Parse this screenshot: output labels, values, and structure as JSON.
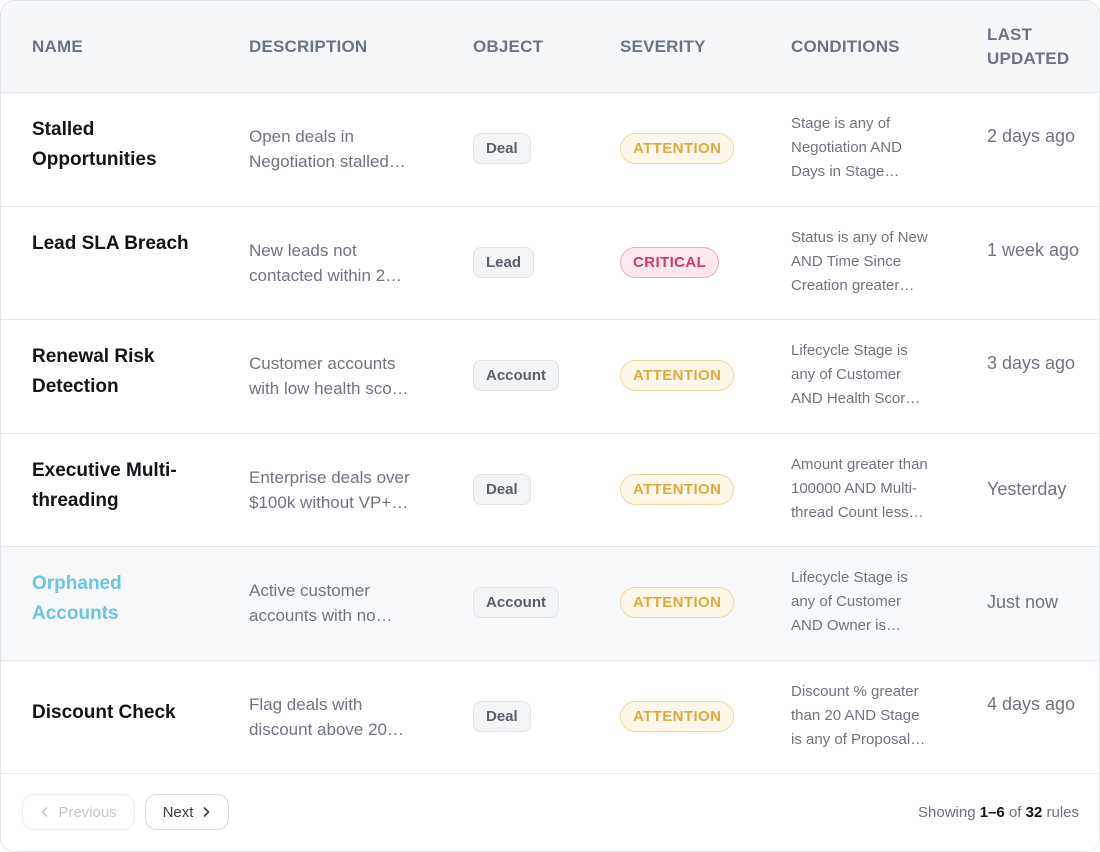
{
  "table": {
    "headers": {
      "name": "NAME",
      "description": "DESCRIPTION",
      "object": "OBJECT",
      "severity": "SEVERITY",
      "conditions": "CONDITIONS",
      "last_updated_line1": "LAST",
      "last_updated_line2": "UPDATED"
    },
    "rows": [
      {
        "name": "Stalled Opportunities",
        "desc_line1": "Open deals in",
        "desc_line2": "Negotiation stalled…",
        "object": "Deal",
        "severity": "ATTENTION",
        "cond_line1": "Stage is any of",
        "cond_line2": "Negotiation AND",
        "cond_line3": "Days in Stage…",
        "updated": "2 days ago"
      },
      {
        "name": "Lead SLA Breach",
        "desc_line1": "New leads not",
        "desc_line2": "contacted within 2…",
        "object": "Lead",
        "severity": "CRITICAL",
        "cond_line1": "Status is any of New",
        "cond_line2": "AND Time Since",
        "cond_line3": "Creation greater…",
        "updated": "1 week ago"
      },
      {
        "name": "Renewal Risk Detection",
        "desc_line1": "Customer accounts",
        "desc_line2": "with low health sco…",
        "object": "Account",
        "severity": "ATTENTION",
        "cond_line1": "Lifecycle Stage is",
        "cond_line2": "any of Customer",
        "cond_line3": "AND Health Scor…",
        "updated": "3 days ago"
      },
      {
        "name": "Executive Multi-threading",
        "desc_line1": "Enterprise deals over",
        "desc_line2": "$100k without VP+…",
        "object": "Deal",
        "severity": "ATTENTION",
        "cond_line1": "Amount greater than",
        "cond_line2": "100000 AND Multi-",
        "cond_line3": "thread Count less…",
        "updated": "Yesterday"
      },
      {
        "name": "Orphaned Accounts",
        "desc_line1": "Active customer",
        "desc_line2": "accounts with no…",
        "object": "Account",
        "severity": "ATTENTION",
        "cond_line1": "Lifecycle Stage is",
        "cond_line2": "any of Customer",
        "cond_line3": "AND Owner is…",
        "updated": "Just now"
      },
      {
        "name": "Discount Check",
        "desc_line1": "Flag deals with",
        "desc_line2": "discount above 20…",
        "object": "Deal",
        "severity": "ATTENTION",
        "cond_line1": "Discount % greater",
        "cond_line2": "than 20 AND Stage",
        "cond_line3": "is any of Proposal…",
        "updated": "4 days ago"
      }
    ]
  },
  "pagination": {
    "previous_label": "Previous",
    "next_label": "Next",
    "showing_prefix": "Showing",
    "range": "1–6",
    "of_text": "of",
    "total": "32",
    "suffix": "rules"
  },
  "colors": {
    "attention": "#e2a93a",
    "critical": "#d33a5e",
    "hover_link": "#6cc4e4"
  }
}
